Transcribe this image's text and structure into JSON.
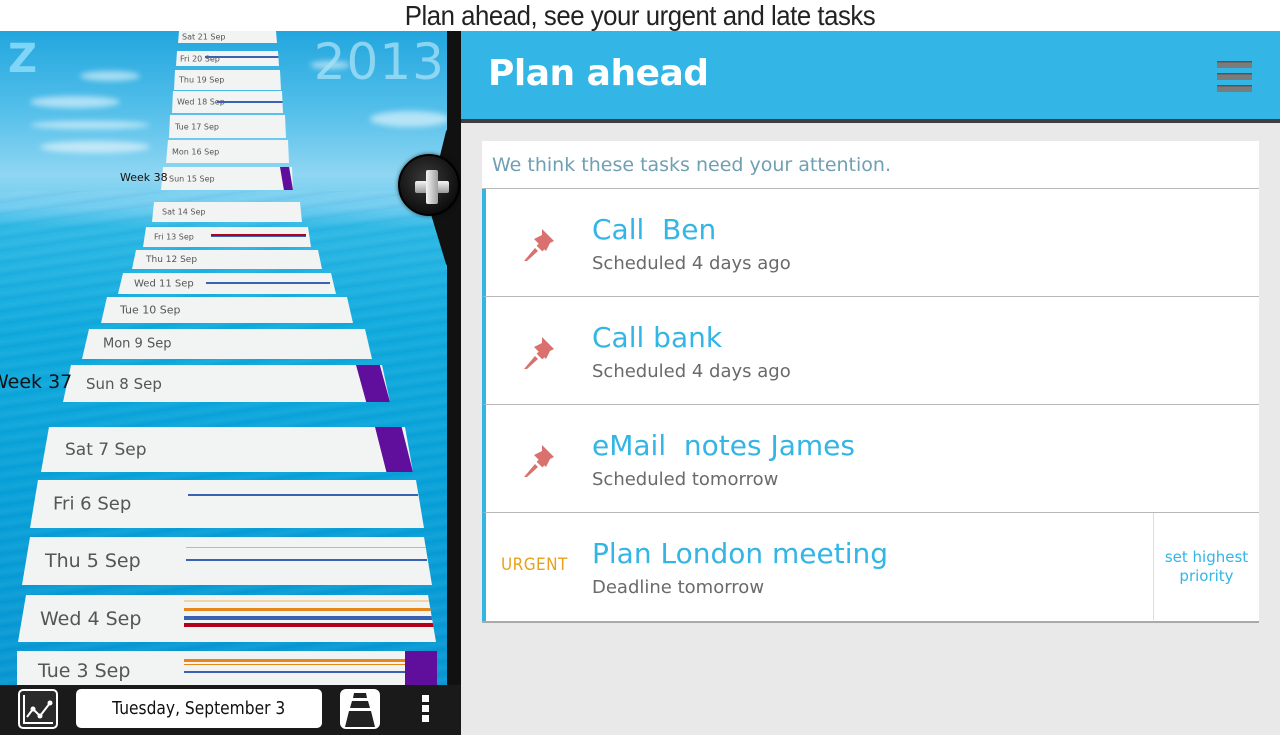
{
  "caption": "Plan ahead, see your urgent and late tasks",
  "left_panel": {
    "logo": "Z",
    "year": "2013",
    "weeks": [
      {
        "label": "Week 38"
      },
      {
        "label": "Week 37"
      }
    ],
    "days": [
      {
        "label": "Sat 21 Sep"
      },
      {
        "label": "Fri 20 Sep"
      },
      {
        "label": "Thu 19 Sep"
      },
      {
        "label": "Wed 18 Sep"
      },
      {
        "label": "Tue 17 Sep"
      },
      {
        "label": "Mon 16 Sep"
      },
      {
        "label": "Sun 15 Sep"
      },
      {
        "label": "Sat 14 Sep"
      },
      {
        "label": "Fri 13 Sep"
      },
      {
        "label": "Thu 12 Sep"
      },
      {
        "label": "Wed 11 Sep"
      },
      {
        "label": "Tue 10 Sep"
      },
      {
        "label": "Mon 9 Sep"
      },
      {
        "label": "Sun 8 Sep"
      },
      {
        "label": "Sat 7 Sep"
      },
      {
        "label": "Fri 6 Sep"
      },
      {
        "label": "Thu 5 Sep"
      },
      {
        "label": "Wed 4 Sep"
      },
      {
        "label": "Tue 3 Sep"
      }
    ],
    "colors": {
      "weekend": "#5f0f9c",
      "blue": "#3b62b0",
      "red": "#b3001b",
      "orange": "#e8861a",
      "pale": "#f2d3a6",
      "paleblue": "#a9b8e0"
    },
    "add_button": {
      "icon": "plus-icon"
    }
  },
  "bottom_bar": {
    "chart_button": {
      "icon": "line-chart-icon"
    },
    "date": "Tuesday, September 3",
    "road_button": {
      "icon": "road-view-icon"
    },
    "more_button": {
      "icon": "overflow-menu-icon"
    }
  },
  "header": {
    "title": "Plan ahead",
    "menu_icon": "hamburger-menu-icon",
    "color": "#33b5e5"
  },
  "attention": {
    "intro": "We think these tasks need your attention.",
    "tasks": [
      {
        "icon": "pushpin-icon",
        "name": "Call  Ben",
        "sub": "Scheduled 4 days ago"
      },
      {
        "icon": "pushpin-icon",
        "name": "Call bank",
        "sub": "Scheduled 4 days ago"
      },
      {
        "icon": "pushpin-icon",
        "name": "eMail  notes James",
        "sub": "Scheduled tomorrow"
      },
      {
        "badge": "URGENT",
        "name": "Plan London meeting",
        "sub": "Deadline tomorrow",
        "action": "set highest priority"
      }
    ]
  }
}
